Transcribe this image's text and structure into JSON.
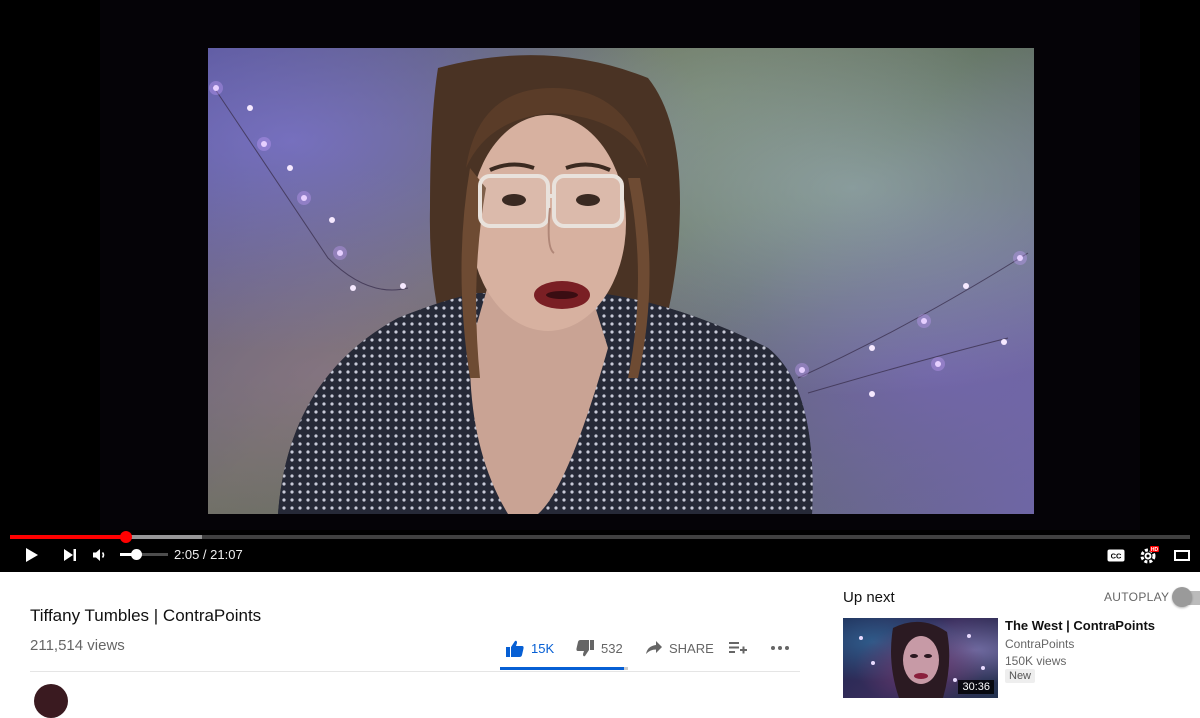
{
  "player": {
    "current_time": "2:05",
    "duration": "21:07",
    "time_display": "2:05 / 21:07",
    "progress_played": 0.0987,
    "progress_buffered": 0.163,
    "volume": 0.33,
    "accent_color": "#ff0000",
    "icons": [
      "play-icon",
      "next-icon",
      "volume-icon",
      "captions-icon",
      "settings-icon",
      "hd-badge",
      "theater-icon"
    ],
    "hd_badge": "HD"
  },
  "video": {
    "title": "Tiffany Tumbles | ContraPoints",
    "views": "211,514 views",
    "likes": "15K",
    "dislikes": "532",
    "share_label": "SHARE",
    "like_ratio": 0.966,
    "like_color": "#065fd4"
  },
  "sidebar": {
    "up_next_label": "Up next",
    "autoplay_label": "AUTOPLAY",
    "autoplay_on": false,
    "next_video": {
      "title": "The West | ContraPoints",
      "channel": "ContraPoints",
      "views": "150K views",
      "badge": "New",
      "duration": "30:36"
    }
  }
}
